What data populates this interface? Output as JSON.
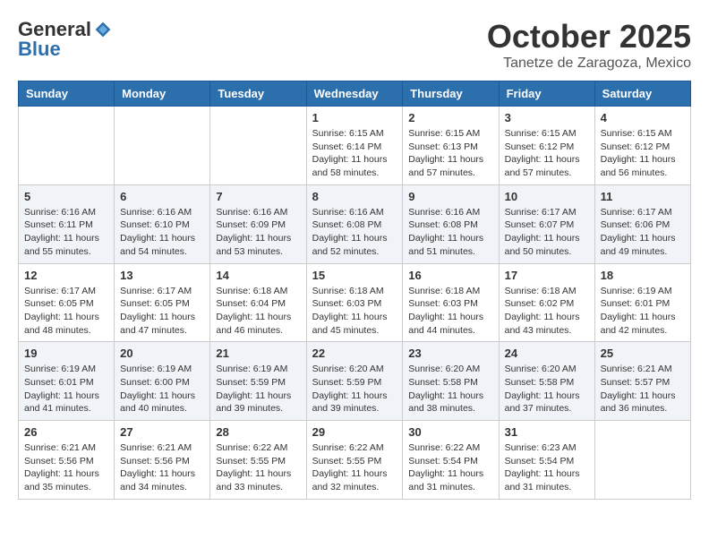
{
  "logo": {
    "general": "General",
    "blue": "Blue"
  },
  "header": {
    "month": "October 2025",
    "location": "Tanetze de Zaragoza, Mexico"
  },
  "weekdays": [
    "Sunday",
    "Monday",
    "Tuesday",
    "Wednesday",
    "Thursday",
    "Friday",
    "Saturday"
  ],
  "weeks": [
    [
      {
        "day": "",
        "sunrise": "",
        "sunset": "",
        "daylight": ""
      },
      {
        "day": "",
        "sunrise": "",
        "sunset": "",
        "daylight": ""
      },
      {
        "day": "",
        "sunrise": "",
        "sunset": "",
        "daylight": ""
      },
      {
        "day": "1",
        "sunrise": "Sunrise: 6:15 AM",
        "sunset": "Sunset: 6:14 PM",
        "daylight": "Daylight: 11 hours and 58 minutes."
      },
      {
        "day": "2",
        "sunrise": "Sunrise: 6:15 AM",
        "sunset": "Sunset: 6:13 PM",
        "daylight": "Daylight: 11 hours and 57 minutes."
      },
      {
        "day": "3",
        "sunrise": "Sunrise: 6:15 AM",
        "sunset": "Sunset: 6:12 PM",
        "daylight": "Daylight: 11 hours and 57 minutes."
      },
      {
        "day": "4",
        "sunrise": "Sunrise: 6:15 AM",
        "sunset": "Sunset: 6:12 PM",
        "daylight": "Daylight: 11 hours and 56 minutes."
      }
    ],
    [
      {
        "day": "5",
        "sunrise": "Sunrise: 6:16 AM",
        "sunset": "Sunset: 6:11 PM",
        "daylight": "Daylight: 11 hours and 55 minutes."
      },
      {
        "day": "6",
        "sunrise": "Sunrise: 6:16 AM",
        "sunset": "Sunset: 6:10 PM",
        "daylight": "Daylight: 11 hours and 54 minutes."
      },
      {
        "day": "7",
        "sunrise": "Sunrise: 6:16 AM",
        "sunset": "Sunset: 6:09 PM",
        "daylight": "Daylight: 11 hours and 53 minutes."
      },
      {
        "day": "8",
        "sunrise": "Sunrise: 6:16 AM",
        "sunset": "Sunset: 6:08 PM",
        "daylight": "Daylight: 11 hours and 52 minutes."
      },
      {
        "day": "9",
        "sunrise": "Sunrise: 6:16 AM",
        "sunset": "Sunset: 6:08 PM",
        "daylight": "Daylight: 11 hours and 51 minutes."
      },
      {
        "day": "10",
        "sunrise": "Sunrise: 6:17 AM",
        "sunset": "Sunset: 6:07 PM",
        "daylight": "Daylight: 11 hours and 50 minutes."
      },
      {
        "day": "11",
        "sunrise": "Sunrise: 6:17 AM",
        "sunset": "Sunset: 6:06 PM",
        "daylight": "Daylight: 11 hours and 49 minutes."
      }
    ],
    [
      {
        "day": "12",
        "sunrise": "Sunrise: 6:17 AM",
        "sunset": "Sunset: 6:05 PM",
        "daylight": "Daylight: 11 hours and 48 minutes."
      },
      {
        "day": "13",
        "sunrise": "Sunrise: 6:17 AM",
        "sunset": "Sunset: 6:05 PM",
        "daylight": "Daylight: 11 hours and 47 minutes."
      },
      {
        "day": "14",
        "sunrise": "Sunrise: 6:18 AM",
        "sunset": "Sunset: 6:04 PM",
        "daylight": "Daylight: 11 hours and 46 minutes."
      },
      {
        "day": "15",
        "sunrise": "Sunrise: 6:18 AM",
        "sunset": "Sunset: 6:03 PM",
        "daylight": "Daylight: 11 hours and 45 minutes."
      },
      {
        "day": "16",
        "sunrise": "Sunrise: 6:18 AM",
        "sunset": "Sunset: 6:03 PM",
        "daylight": "Daylight: 11 hours and 44 minutes."
      },
      {
        "day": "17",
        "sunrise": "Sunrise: 6:18 AM",
        "sunset": "Sunset: 6:02 PM",
        "daylight": "Daylight: 11 hours and 43 minutes."
      },
      {
        "day": "18",
        "sunrise": "Sunrise: 6:19 AM",
        "sunset": "Sunset: 6:01 PM",
        "daylight": "Daylight: 11 hours and 42 minutes."
      }
    ],
    [
      {
        "day": "19",
        "sunrise": "Sunrise: 6:19 AM",
        "sunset": "Sunset: 6:01 PM",
        "daylight": "Daylight: 11 hours and 41 minutes."
      },
      {
        "day": "20",
        "sunrise": "Sunrise: 6:19 AM",
        "sunset": "Sunset: 6:00 PM",
        "daylight": "Daylight: 11 hours and 40 minutes."
      },
      {
        "day": "21",
        "sunrise": "Sunrise: 6:19 AM",
        "sunset": "Sunset: 5:59 PM",
        "daylight": "Daylight: 11 hours and 39 minutes."
      },
      {
        "day": "22",
        "sunrise": "Sunrise: 6:20 AM",
        "sunset": "Sunset: 5:59 PM",
        "daylight": "Daylight: 11 hours and 39 minutes."
      },
      {
        "day": "23",
        "sunrise": "Sunrise: 6:20 AM",
        "sunset": "Sunset: 5:58 PM",
        "daylight": "Daylight: 11 hours and 38 minutes."
      },
      {
        "day": "24",
        "sunrise": "Sunrise: 6:20 AM",
        "sunset": "Sunset: 5:58 PM",
        "daylight": "Daylight: 11 hours and 37 minutes."
      },
      {
        "day": "25",
        "sunrise": "Sunrise: 6:21 AM",
        "sunset": "Sunset: 5:57 PM",
        "daylight": "Daylight: 11 hours and 36 minutes."
      }
    ],
    [
      {
        "day": "26",
        "sunrise": "Sunrise: 6:21 AM",
        "sunset": "Sunset: 5:56 PM",
        "daylight": "Daylight: 11 hours and 35 minutes."
      },
      {
        "day": "27",
        "sunrise": "Sunrise: 6:21 AM",
        "sunset": "Sunset: 5:56 PM",
        "daylight": "Daylight: 11 hours and 34 minutes."
      },
      {
        "day": "28",
        "sunrise": "Sunrise: 6:22 AM",
        "sunset": "Sunset: 5:55 PM",
        "daylight": "Daylight: 11 hours and 33 minutes."
      },
      {
        "day": "29",
        "sunrise": "Sunrise: 6:22 AM",
        "sunset": "Sunset: 5:55 PM",
        "daylight": "Daylight: 11 hours and 32 minutes."
      },
      {
        "day": "30",
        "sunrise": "Sunrise: 6:22 AM",
        "sunset": "Sunset: 5:54 PM",
        "daylight": "Daylight: 11 hours and 31 minutes."
      },
      {
        "day": "31",
        "sunrise": "Sunrise: 6:23 AM",
        "sunset": "Sunset: 5:54 PM",
        "daylight": "Daylight: 11 hours and 31 minutes."
      },
      {
        "day": "",
        "sunrise": "",
        "sunset": "",
        "daylight": ""
      }
    ]
  ]
}
